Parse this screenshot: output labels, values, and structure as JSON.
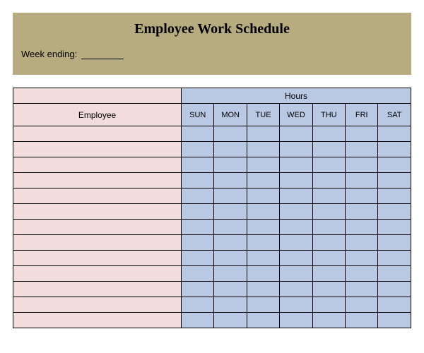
{
  "title": "Employee Work Schedule",
  "week_ending_label": "Week ending:",
  "week_ending_value": "",
  "headers": {
    "employee": "Employee",
    "hours": "Hours",
    "days": [
      "SUN",
      "MON",
      "TUE",
      "WED",
      "THU",
      "FRI",
      "SAT"
    ]
  },
  "rows": [
    {
      "employee": "",
      "hours": [
        "",
        "",
        "",
        "",
        "",
        "",
        ""
      ]
    },
    {
      "employee": "",
      "hours": [
        "",
        "",
        "",
        "",
        "",
        "",
        ""
      ]
    },
    {
      "employee": "",
      "hours": [
        "",
        "",
        "",
        "",
        "",
        "",
        ""
      ]
    },
    {
      "employee": "",
      "hours": [
        "",
        "",
        "",
        "",
        "",
        "",
        ""
      ]
    },
    {
      "employee": "",
      "hours": [
        "",
        "",
        "",
        "",
        "",
        "",
        ""
      ]
    },
    {
      "employee": "",
      "hours": [
        "",
        "",
        "",
        "",
        "",
        "",
        ""
      ]
    },
    {
      "employee": "",
      "hours": [
        "",
        "",
        "",
        "",
        "",
        "",
        ""
      ]
    },
    {
      "employee": "",
      "hours": [
        "",
        "",
        "",
        "",
        "",
        "",
        ""
      ]
    },
    {
      "employee": "",
      "hours": [
        "",
        "",
        "",
        "",
        "",
        "",
        ""
      ]
    },
    {
      "employee": "",
      "hours": [
        "",
        "",
        "",
        "",
        "",
        "",
        ""
      ]
    },
    {
      "employee": "",
      "hours": [
        "",
        "",
        "",
        "",
        "",
        "",
        ""
      ]
    },
    {
      "employee": "",
      "hours": [
        "",
        "",
        "",
        "",
        "",
        "",
        ""
      ]
    },
    {
      "employee": "",
      "hours": [
        "",
        "",
        "",
        "",
        "",
        "",
        ""
      ]
    }
  ]
}
